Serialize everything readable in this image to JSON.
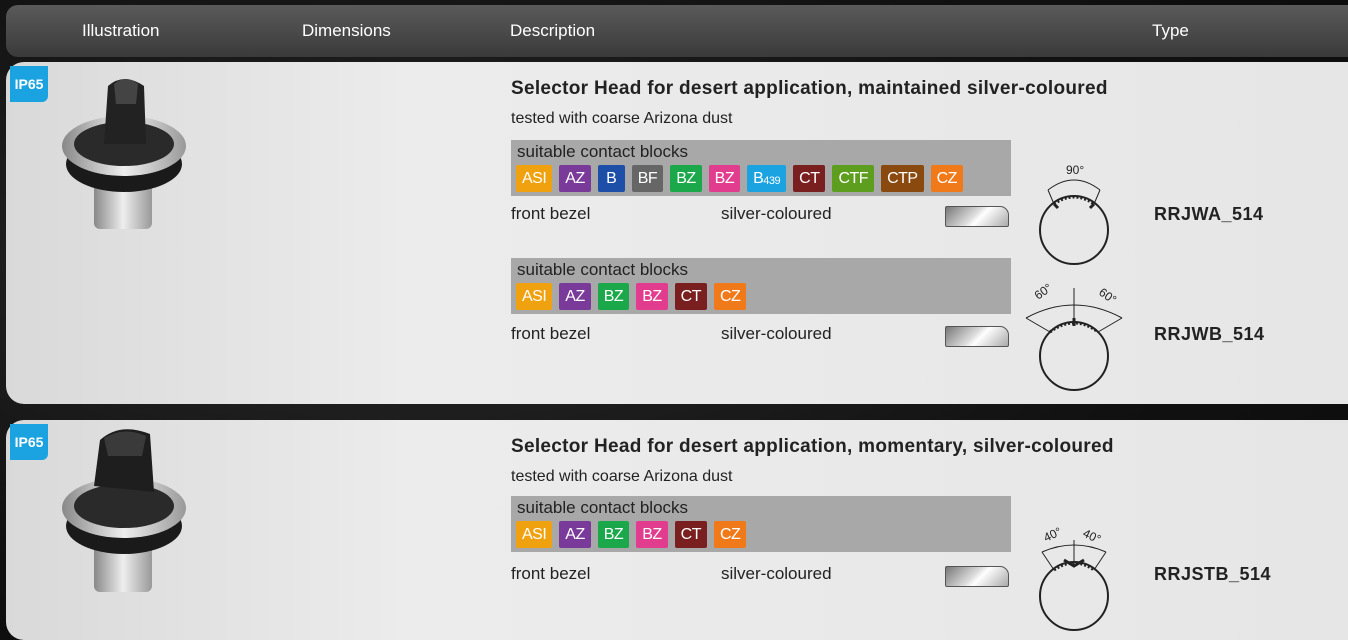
{
  "header": {
    "illustration": "Illustration",
    "dimensions": "Dimensions",
    "description": "Description",
    "type": "Type"
  },
  "products": [
    {
      "badge": "IP65",
      "title": "Selector Head for desert application, maintained silver-coloured",
      "subtitle": "tested with coarse Arizona dust",
      "variants": [
        {
          "contact_label": "suitable contact blocks",
          "chips": [
            {
              "label": "ASI",
              "color": "#f0a10f"
            },
            {
              "label": "AZ",
              "color": "#7a3a9a"
            },
            {
              "label": "B",
              "color": "#1d4fa8"
            },
            {
              "label": "BF",
              "color": "#666666"
            },
            {
              "label": "BZ",
              "color": "#1aa84a"
            },
            {
              "label": "BZ",
              "color": "#e23c8e"
            },
            {
              "label": "B",
              "sub": "439",
              "color": "#1aa3e0"
            },
            {
              "label": "CT",
              "color": "#7a1f1f"
            },
            {
              "label": "CTF",
              "color": "#5e9e1e"
            },
            {
              "label": "CTP",
              "color": "#8a4a0f"
            },
            {
              "label": "CZ",
              "color": "#f07a1a"
            }
          ],
          "bezel_label": "front bezel",
          "bezel_value": "silver-coloured",
          "angles": [
            "90°"
          ],
          "type": "RRJWA_514"
        },
        {
          "contact_label": "suitable contact blocks",
          "chips": [
            {
              "label": "ASI",
              "color": "#f0a10f"
            },
            {
              "label": "AZ",
              "color": "#7a3a9a"
            },
            {
              "label": "BZ",
              "color": "#1aa84a"
            },
            {
              "label": "BZ",
              "color": "#e23c8e"
            },
            {
              "label": "CT",
              "color": "#7a1f1f"
            },
            {
              "label": "CZ",
              "color": "#f07a1a"
            }
          ],
          "bezel_label": "front bezel",
          "bezel_value": "silver-coloured",
          "angles": [
            "60°",
            "60°"
          ],
          "type": "RRJWB_514"
        }
      ]
    },
    {
      "badge": "IP65",
      "title": "Selector Head for desert application, momentary, silver-coloured",
      "subtitle": "tested with coarse Arizona dust",
      "variants": [
        {
          "contact_label": "suitable contact blocks",
          "chips": [
            {
              "label": "ASI",
              "color": "#f0a10f"
            },
            {
              "label": "AZ",
              "color": "#7a3a9a"
            },
            {
              "label": "BZ",
              "color": "#1aa84a"
            },
            {
              "label": "BZ",
              "color": "#e23c8e"
            },
            {
              "label": "CT",
              "color": "#7a1f1f"
            },
            {
              "label": "CZ",
              "color": "#f07a1a"
            }
          ],
          "bezel_label": "front bezel",
          "bezel_value": "silver-coloured",
          "angles": [
            "40°",
            "40°"
          ],
          "type": "RRJSTB_514"
        }
      ]
    }
  ]
}
